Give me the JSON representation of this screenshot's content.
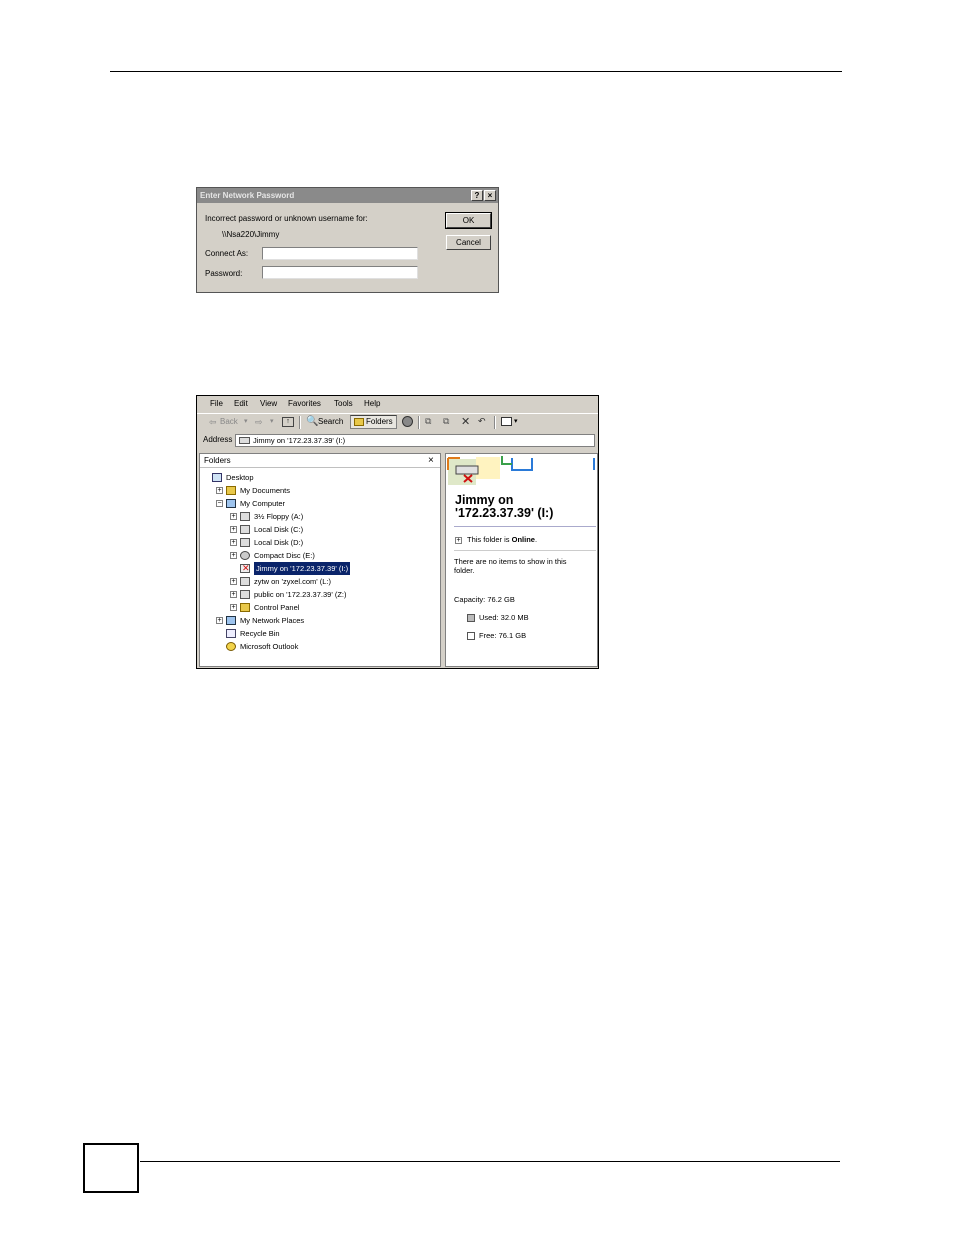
{
  "dialog": {
    "title": "Enter Network Password",
    "help_glyph": "?",
    "close_glyph": "×",
    "message": "Incorrect password or unknown username for:",
    "share_path": "\\\\Nsa220\\Jimmy",
    "connect_as_label": "Connect As:",
    "connect_as_value": "",
    "password_label": "Password:",
    "password_value": "",
    "ok_label": "OK",
    "cancel_label": "Cancel"
  },
  "explorer": {
    "menu": [
      "File",
      "Edit",
      "View",
      "Favorites",
      "Tools",
      "Help"
    ],
    "toolbar": {
      "back_label": "Back",
      "search_label": "Search",
      "folders_label": "Folders"
    },
    "address_label": "Address",
    "address_value": "Jimmy on '172.23.37.39' (I:)",
    "folders_header": "Folders",
    "folders_close": "×",
    "tree": [
      {
        "label": "Desktop",
        "expander": "",
        "selected": false
      },
      {
        "label": "My Documents",
        "expander": "+",
        "selected": false
      },
      {
        "label": "My Computer",
        "expander": "−",
        "selected": false
      },
      {
        "label": "3½ Floppy (A:)",
        "expander": "+",
        "selected": false
      },
      {
        "label": "Local Disk (C:)",
        "expander": "+",
        "selected": false
      },
      {
        "label": "Local Disk (D:)",
        "expander": "+",
        "selected": false
      },
      {
        "label": "Compact Disc (E:)",
        "expander": "+",
        "selected": false
      },
      {
        "label": "Jimmy on '172.23.37.39' (I:)",
        "expander": "",
        "selected": true
      },
      {
        "label": "zytw on 'zyxel.com' (L:)",
        "expander": "+",
        "selected": false
      },
      {
        "label": "public on '172.23.37.39' (Z:)",
        "expander": "+",
        "selected": false
      },
      {
        "label": "Control Panel",
        "expander": "+",
        "selected": false
      },
      {
        "label": "My Network Places",
        "expander": "+",
        "selected": false
      },
      {
        "label": "Recycle Bin",
        "expander": "",
        "selected": false
      },
      {
        "label": "Microsoft Outlook",
        "expander": "",
        "selected": false
      }
    ],
    "detail": {
      "title_line1": "Jimmy on",
      "title_line2": "'172.23.37.39' (I:)",
      "status_prefix": "This folder is ",
      "status_value": "Online",
      "status_suffix": ".",
      "empty_line1": "There are no items to show in this",
      "empty_line2": "folder.",
      "capacity": "Capacity: 76.2 GB",
      "used": "Used: 32.0 MB",
      "free": "Free: 76.1 GB"
    }
  }
}
